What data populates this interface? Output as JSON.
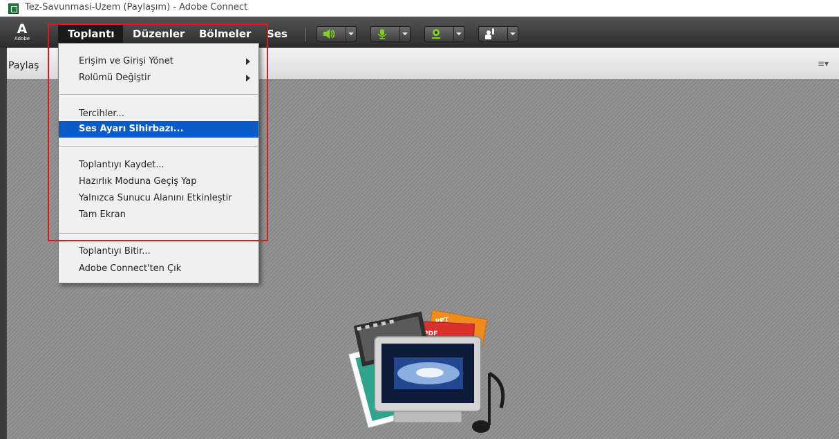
{
  "window": {
    "title": "Tez-Savunmasi-Uzem (Paylaşım) - Adobe Connect",
    "icon": "adobe-connect-app-icon"
  },
  "logo": {
    "glyph": "A",
    "text": "Adobe"
  },
  "menubar": {
    "items": [
      {
        "label": "Toplantı",
        "active": true
      },
      {
        "label": "Düzenler",
        "active": false
      },
      {
        "label": "Bölmeler",
        "active": false
      },
      {
        "label": "Ses",
        "active": false
      }
    ],
    "tools": [
      {
        "name": "speaker-icon",
        "color": "#7ed321"
      },
      {
        "name": "microphone-icon",
        "color": "#7ed321"
      },
      {
        "name": "webcam-icon",
        "color": "#7ed321"
      },
      {
        "name": "raise-hand-icon",
        "color": "#ffffff"
      }
    ]
  },
  "pod": {
    "title": "Paylaş",
    "menu_icon": "≡▾"
  },
  "dropdown": {
    "items": [
      {
        "label": "Erişim ve Girişi Yönet",
        "submenu": true
      },
      {
        "label": "Rolümü Değiştir",
        "submenu": true
      },
      {
        "label": "Tercihler...",
        "submenu": false
      },
      {
        "label": "Ses Ayarı Sihirbazı...",
        "submenu": false,
        "highlighted": true
      },
      {
        "label": "Toplantıyı Kaydet...",
        "submenu": false
      },
      {
        "label": "Hazırlık Moduna Geçiş Yap",
        "submenu": false
      },
      {
        "label": "Yalnızca Sunucu Alanını Etkinleştir",
        "submenu": false
      },
      {
        "label": "Tam Ekran",
        "submenu": false
      },
      {
        "label": "Toplantıyı Bitir...",
        "submenu": false
      },
      {
        "label": "Adobe Connect'ten Çık",
        "submenu": false
      }
    ]
  },
  "illustration": {
    "icon": "share-content-icon",
    "doc_labels": [
      "PPT",
      "PDF"
    ]
  },
  "colors": {
    "menubar": "#3a3a3a",
    "highlight": "#0a5ac8",
    "annotation": "#e0161b",
    "content_bg": "#8e8e8e"
  }
}
